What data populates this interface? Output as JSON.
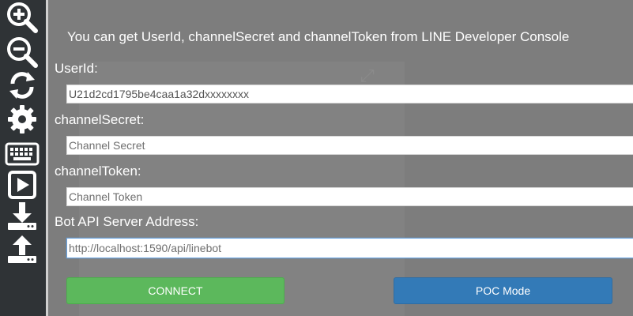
{
  "toolbar": {
    "items": [
      {
        "icon": "zoom-in-icon"
      },
      {
        "icon": "zoom-out-icon"
      },
      {
        "icon": "refresh-icon"
      },
      {
        "icon": "gear-icon"
      },
      {
        "icon": "keyboard-icon"
      },
      {
        "icon": "play-icon"
      },
      {
        "icon": "download-icon"
      },
      {
        "icon": "upload-icon"
      }
    ],
    "background": "#2f3336",
    "icon_color": "#ffffff"
  },
  "modal": {
    "title": "You can get UserId, channelSecret and channelToken from LINE Developer Console",
    "fields": {
      "user_id": {
        "label": "UserId:",
        "value": "U21d2cd1795be4caa1a32dxxxxxxxx",
        "placeholder": ""
      },
      "channel_secret": {
        "label": "channelSecret:",
        "value": "",
        "placeholder": "Channel Secret"
      },
      "channel_token": {
        "label": "channelToken:",
        "value": "",
        "placeholder": "Channel Token"
      },
      "server_address": {
        "label": "Bot API Server Address:",
        "value": "",
        "placeholder": "http://localhost:1590/api/linebot"
      }
    },
    "buttons": {
      "connect": "CONNECT",
      "poc_mode": "POC Mode"
    }
  },
  "colors": {
    "connect": "#5cb85c",
    "poc_mode": "#337ab7",
    "overlay": "#7a7a7a"
  }
}
